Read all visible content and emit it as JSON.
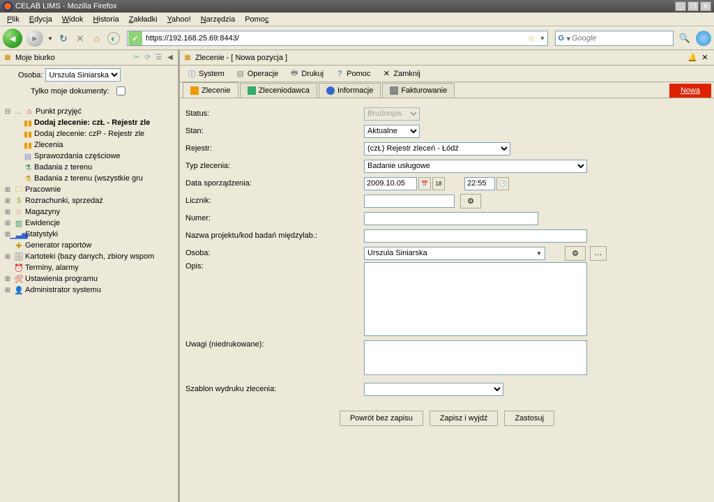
{
  "window": {
    "title": "CELAB LIMS - Mozilla Firefox"
  },
  "menubar": [
    "Plik",
    "Edycja",
    "Widok",
    "Historia",
    "Zakładki",
    "Yahoo!",
    "Narzędzia",
    "Pomoc"
  ],
  "url": "https://192.168.25.69:8443/",
  "search_placeholder": "Google",
  "sidebar": {
    "title": "Moje biurko",
    "osoba_label": "Osoba:",
    "osoba_value": "Urszula Siniarska",
    "tylko_label": "Tylko moje dokumenty:",
    "tree_root": "Punkt przyjęć",
    "tree_children": [
      "Dodaj zlecenie: czŁ - Rejestr zle",
      "Dodaj zlecenie: czP - Rejestr zle",
      "Zlecenia",
      "Sprawozdania częściowe",
      "Badania z terenu",
      "Badania z terenu (wszystkie gru"
    ],
    "tree_roots2": [
      "Pracownie",
      "Rozrachunki, sprzedaż",
      "Magazyny",
      "Ewidencje",
      "Statystyki",
      "Generator raportów",
      "Kartoteki (bazy danych, zbiory wspom",
      "Terminy, alarmy",
      "Ustawienia programu",
      "Administrator systemu"
    ]
  },
  "content": {
    "header": "Zlecenie - [ Nowa pozycja ]",
    "toolbar": {
      "system": "System",
      "operacje": "Operacje",
      "drukuj": "Drukuj",
      "pomoc": "Pomoc",
      "zamknij": "Zamknij"
    },
    "tabs": [
      "Zlecenie",
      "Zleceniodawca",
      "Informacje",
      "Fakturowanie"
    ],
    "nowa": "Nowa",
    "labels": {
      "status": "Status:",
      "stan": "Stan:",
      "rejestr": "Rejestr:",
      "typ": "Typ zlecenia:",
      "data": "Data sporządzenia:",
      "licznik": "Licznik:",
      "numer": "Numer:",
      "nazwa": "Nazwa projektu/kod badań międzylab.:",
      "osoba": "Osoba:",
      "opis": "Opis:",
      "uwagi": "Uwagi (niedrukowane):",
      "szablon": "Szablon wydruku zlecenia:"
    },
    "values": {
      "status": "Brudnopis",
      "stan": "Aktualne",
      "rejestr": "(czŁ) Rejestr zleceń - Łódź",
      "typ": "Badanie usługowe",
      "date": "2009.10.05",
      "time": "22:55",
      "osoba": "Urszula Siniarska",
      "szablon": ""
    },
    "buttons": {
      "powrot": "Powrót bez zapisu",
      "zapisz": "Zapisz i wyjdź",
      "zastosuj": "Zastosuj"
    }
  }
}
